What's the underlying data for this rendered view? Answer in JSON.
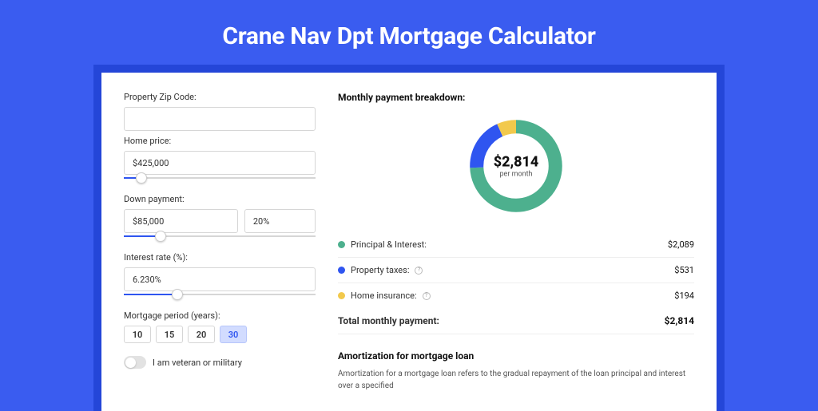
{
  "title": "Crane Nav Dpt Mortgage Calculator",
  "form": {
    "zip": {
      "label": "Property Zip Code:",
      "value": ""
    },
    "price": {
      "label": "Home price:",
      "value": "$425,000",
      "slider_pct": 9
    },
    "down": {
      "label": "Down payment:",
      "amount": "$85,000",
      "pct": "20%",
      "slider_pct": 19
    },
    "rate": {
      "label": "Interest rate (%):",
      "value": "6.230%",
      "slider_pct": 28
    },
    "period": {
      "label": "Mortgage period (years):",
      "options": [
        "10",
        "15",
        "20",
        "30"
      ],
      "active": 3
    },
    "vet": {
      "label": "I am veteran or military",
      "on": false
    }
  },
  "breakdown": {
    "title": "Monthly payment breakdown:",
    "amount": "$2,814",
    "sub": "per month",
    "rows": [
      {
        "label": "Principal & Interest:",
        "value": "$2,089",
        "color": "#4db08e",
        "help": false
      },
      {
        "label": "Property taxes:",
        "value": "$531",
        "color": "#2f55f0",
        "help": true
      },
      {
        "label": "Home insurance:",
        "value": "$194",
        "color": "#f2c94c",
        "help": true
      }
    ],
    "total": {
      "label": "Total monthly payment:",
      "value": "$2,814"
    }
  },
  "amort": {
    "title": "Amortization for mortgage loan",
    "text": "Amortization for a mortgage loan refers to the gradual repayment of the loan principal and interest over a specified"
  },
  "chart_data": {
    "type": "pie",
    "title": "Monthly payment breakdown",
    "series": [
      {
        "name": "Principal & Interest",
        "value": 2089,
        "color": "#4db08e"
      },
      {
        "name": "Property taxes",
        "value": 531,
        "color": "#2f55f0"
      },
      {
        "name": "Home insurance",
        "value": 194,
        "color": "#f2c94c"
      }
    ],
    "total": 2814,
    "unit": "USD per month"
  }
}
